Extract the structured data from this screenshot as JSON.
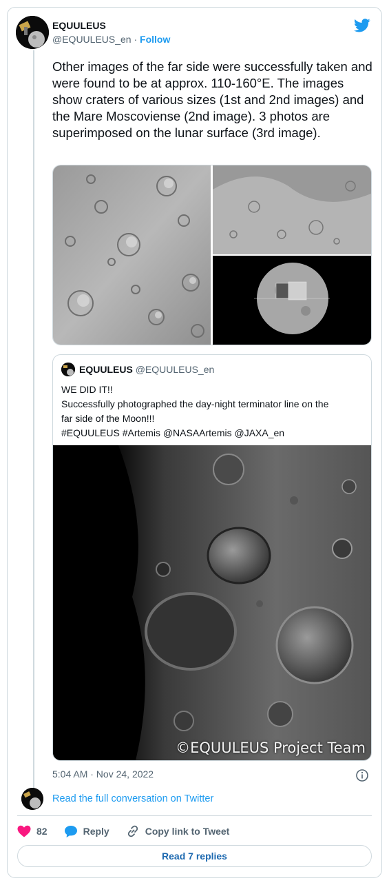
{
  "tweet": {
    "author_name": "EQUULEUS",
    "handle": "@EQUULEUS_en",
    "separator": " · ",
    "follow_label": "Follow",
    "text": "Other images of the far side were successfully taken and were found to be at approx. 110-160°E. The images show craters of various sizes (1st and 2nd images) and the Mare Moscoviense (2nd image). 3 photos are superimposed on the lunar surface (3rd image).",
    "timestamp": "5:04 AM · Nov 24, 2022",
    "read_conversation": "Read the full conversation on Twitter",
    "likes_count": "82",
    "reply_label": "Reply",
    "copy_link_label": "Copy link to Tweet",
    "read_replies_label": "Read 7 replies"
  },
  "quoted": {
    "author_name": "EQUULEUS",
    "handle": "@EQUULEUS_en",
    "lines": [
      "WE DID IT!!",
      "Successfully photographed the day-night terminator line on the",
      "far side of the Moon!!!",
      "#EQUULEUS #Artemis @NASAArtemis @JAXA_en"
    ],
    "image_caption": "©EQUULEUS Project Team"
  },
  "icons": {
    "brand": "twitter-bird-icon",
    "like": "heart-icon",
    "reply": "speech-bubble-icon",
    "copy": "link-icon",
    "info": "info-icon"
  },
  "colors": {
    "accent": "#1d9bf0",
    "like": "#f91880",
    "muted": "#536471",
    "border": "#cfd9de"
  }
}
